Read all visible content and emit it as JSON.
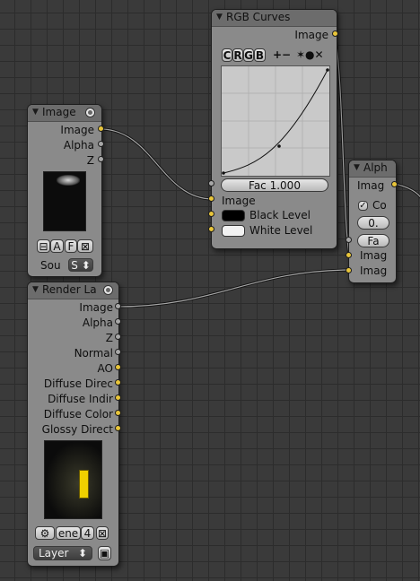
{
  "nodes": {
    "image": {
      "title": "Image",
      "outputs": [
        "Image",
        "Alpha",
        "Z"
      ],
      "buttons": {
        "alpha_btn": "A",
        "f_btn": "F",
        "source_label": "Sou",
        "source_value": "S"
      }
    },
    "rgb_curves": {
      "title": "RGB Curves",
      "output": "Image",
      "channel_buttons": [
        "C",
        "R",
        "G",
        "B"
      ],
      "tool_glyphs": {
        "zoom": "+−",
        "tools": "✶●✕"
      },
      "fac": "Fac 1.000",
      "inputs": [
        "Image",
        "Black Level",
        "White Level"
      ]
    },
    "alpha_over": {
      "title": "Alph",
      "output": "Imag",
      "checkbox_label": "Co",
      "premul_value": "0.",
      "fac_label": "Fa",
      "inputs": [
        "Imag",
        "Imag"
      ]
    },
    "render_layers": {
      "title": "Render La",
      "outputs": [
        "Image",
        "Alpha",
        "Z",
        "Normal",
        "AO",
        "Diffuse Direc",
        "Diffuse Indir",
        "Diffuse Color",
        "Glossy Direct"
      ],
      "scene_value": "ene",
      "scene_count": "4",
      "layer_value": "Layer"
    }
  },
  "colors": {
    "background": "#3a3a3a",
    "node_body": "#8a8a8a",
    "node_header": "#6c6c6c",
    "socket_color": "#e8c53a",
    "socket_gray": "#a8a8a8"
  }
}
